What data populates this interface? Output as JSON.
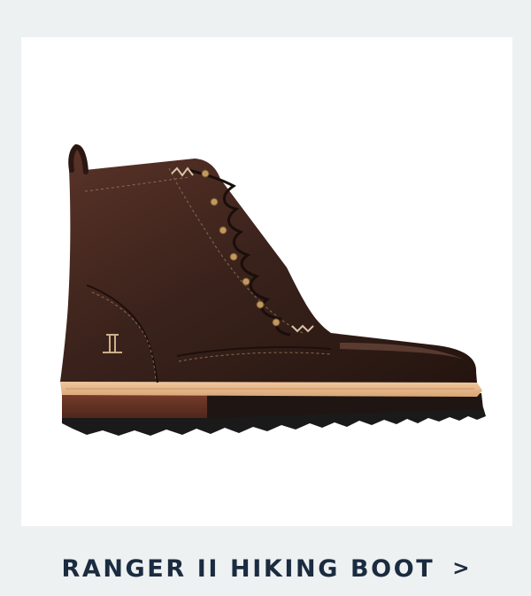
{
  "product": {
    "title": "RANGER II HIKING BOOT",
    "chevron": ">",
    "image_icon": "boot-image"
  },
  "colors": {
    "page_background": "#eef1f1",
    "card_background": "#ffffff",
    "title_color": "#1b2b40",
    "boot_leather": "#3a221b",
    "midsole": "#e7b88b",
    "heel_stack": "#6b3526",
    "outsole": "#1a1a1a"
  }
}
